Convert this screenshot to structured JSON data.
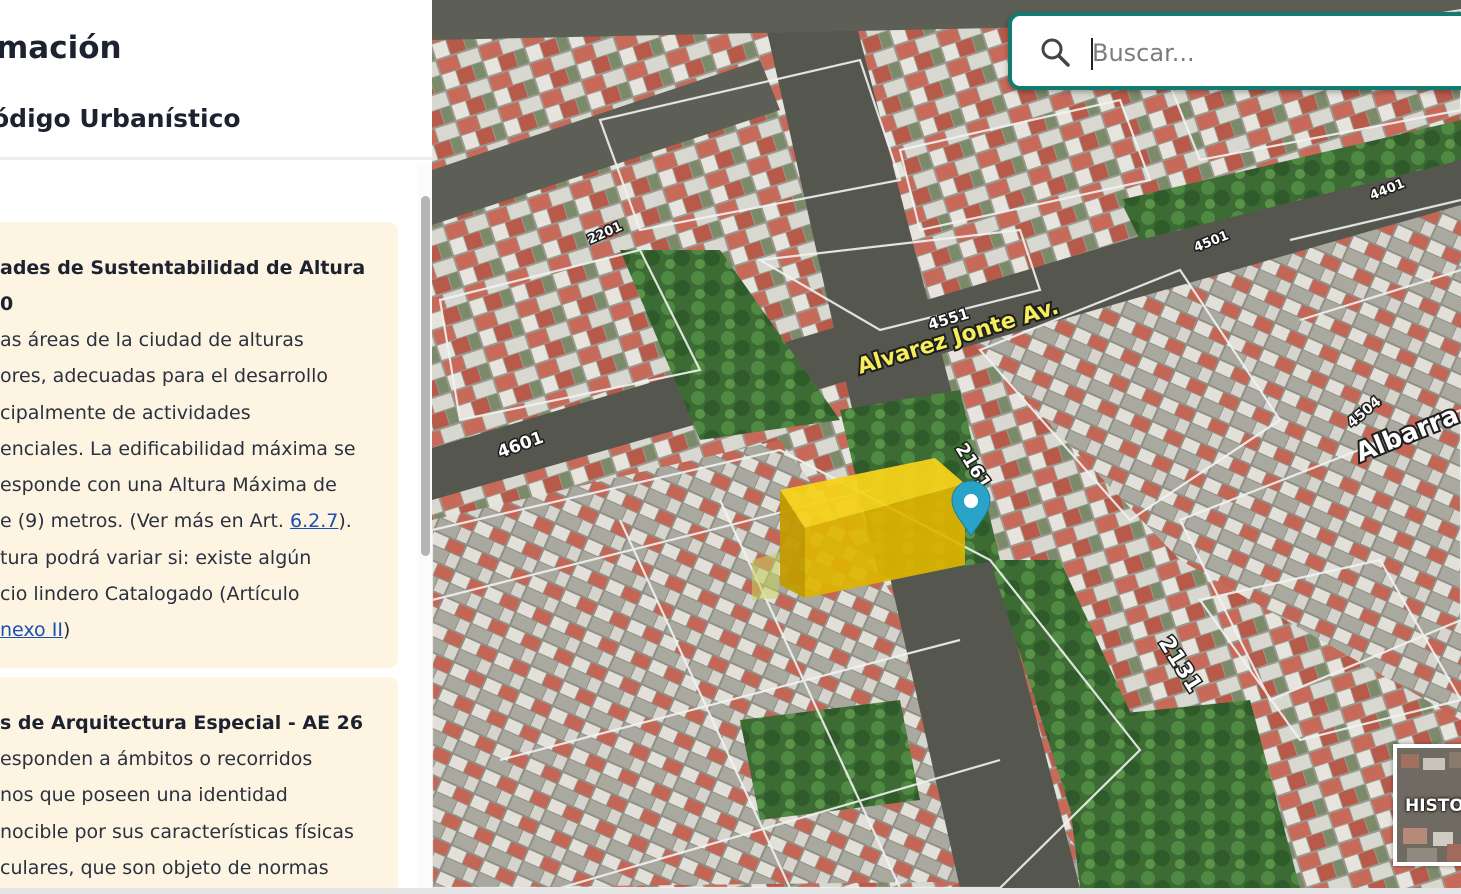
{
  "panel": {
    "title": "mación",
    "subtitle": "ódigo Urbanístico"
  },
  "cards": [
    {
      "heading": "ades de Sustentabilidad de Altura\n0",
      "body_start": "as áreas de la ciudad de alturas\nores, adecuadas para el desarrollo\ncipalmente de actividades\nenciales. La edificabilidad máxima se\nesponde con una Altura Máxima de\ne (9) metros. (Ver más en Art. ",
      "link1": "6.2.7",
      "body_mid": ").\ntura podrá variar si: existe algún\ncio lindero Catalogado (Artículo\n",
      "link2": "nexo II",
      "body_end": ")"
    },
    {
      "heading": "s de Arquitectura Especial - AE 26",
      "body": "esponden a ámbitos o recorridos\nnos que poseen una identidad\nnocible por sus características físicas\nculares, que son objeto de normas"
    }
  ],
  "search": {
    "placeholder": "Buscar..."
  },
  "map": {
    "street_labels": {
      "avenue": "Alvarez Jonte Av.",
      "albarracin": "Albarra",
      "n4551": "4551",
      "n4601": "4601",
      "n2161": "2161",
      "n2131": "2131",
      "n2201": "2201",
      "n4501": "4501",
      "n4504": "4504",
      "n4401": "4401"
    },
    "colors": {
      "building_highlight": "#e8bd00",
      "marker": "#2aa3c9",
      "search_border": "#137a72"
    }
  },
  "history_button": {
    "label": "HISTO"
  }
}
